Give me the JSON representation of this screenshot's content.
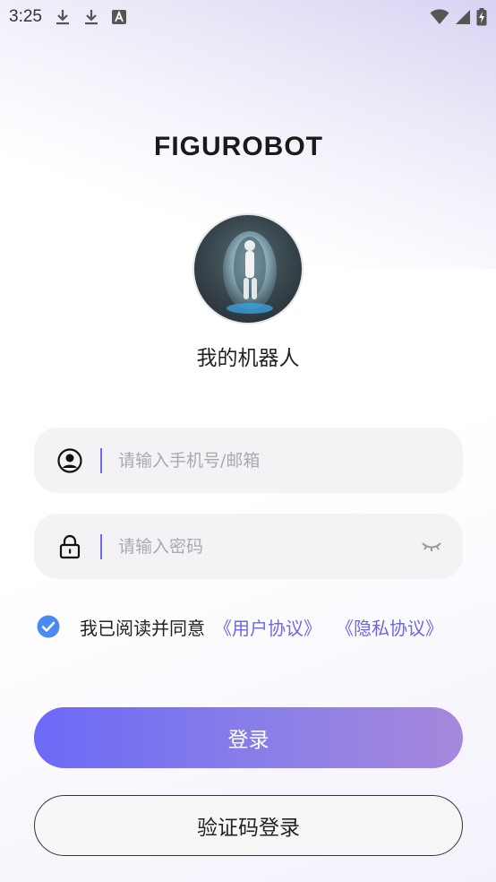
{
  "status_bar": {
    "time": "3:25",
    "left_icons": [
      "download-icon",
      "download-icon",
      "text-a-icon"
    ],
    "right_icons": [
      "wifi-icon",
      "signal-icon",
      "battery-charging-icon"
    ]
  },
  "brand": {
    "logo_text": "FIGUROBOT"
  },
  "robot": {
    "name": "我的机器人"
  },
  "login_form": {
    "phone_placeholder": "请输入手机号/邮箱",
    "password_placeholder": "请输入密码",
    "agreement_text": "我已阅读并同意",
    "user_agreement_link": "《用户协议》",
    "privacy_link": "《隐私协议》",
    "agreement_checked": true
  },
  "actions": {
    "login_label": "登录",
    "sms_login_label": "验证码登录"
  },
  "colors": {
    "accent": "#6c69f6",
    "accent_end": "#a688dc",
    "link": "#6b68e6",
    "check": "#4a8af4",
    "input_bg": "#f3f3f5"
  }
}
